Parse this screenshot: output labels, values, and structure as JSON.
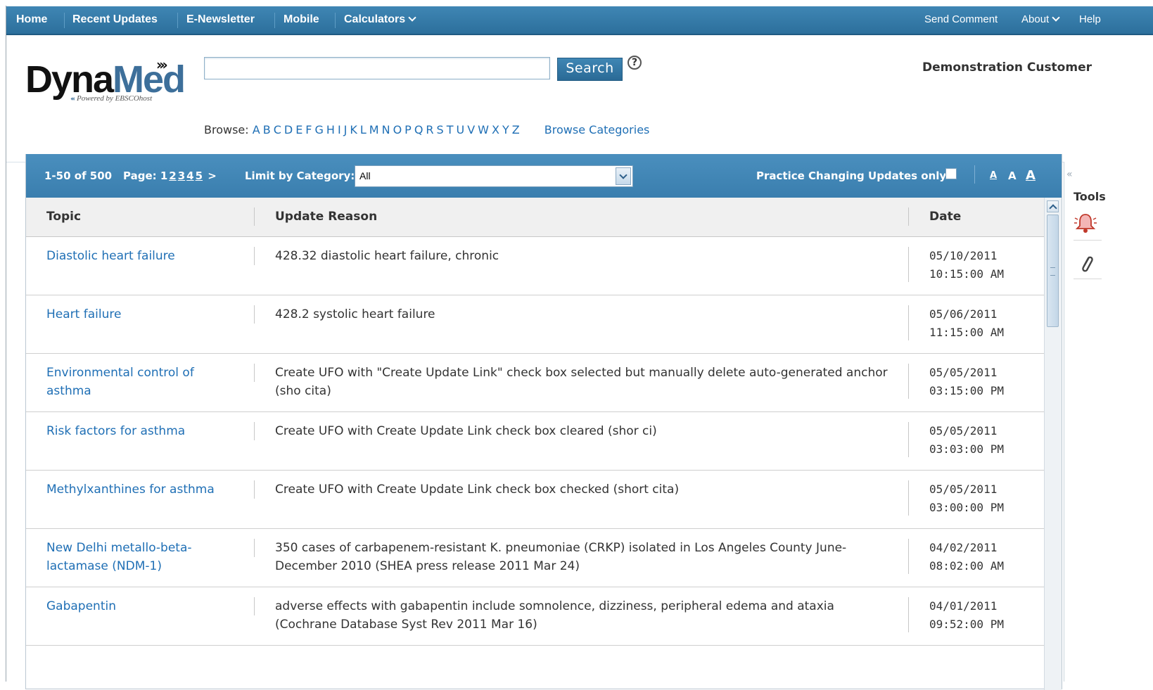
{
  "nav": {
    "left": [
      {
        "label": "Home"
      },
      {
        "label": "Recent Updates"
      },
      {
        "label": "E-Newsletter"
      },
      {
        "label": "Mobile"
      },
      {
        "label": "Calculators"
      }
    ],
    "right": [
      {
        "label": "Send Comment"
      },
      {
        "label": "About"
      },
      {
        "label": "Help"
      }
    ]
  },
  "logo": {
    "part1": "Dyna",
    "part2": "Med",
    "arrows": "›››",
    "powered_arrows": "‹‹‹",
    "powered_by": "Powered by EBSCOhost"
  },
  "search": {
    "value": "",
    "button_label": "Search",
    "help_icon": "?"
  },
  "customer": "Demonstration Customer",
  "browse": {
    "label": "Browse:",
    "letters": [
      "A",
      "B",
      "C",
      "D",
      "E",
      "F",
      "G",
      "H",
      "I",
      "J",
      "K",
      "L",
      "M",
      "N",
      "O",
      "P",
      "Q",
      "R",
      "S",
      "T",
      "U",
      "V",
      "W",
      "X",
      "Y",
      "Z"
    ],
    "categories_link": "Browse Categories"
  },
  "toolbar": {
    "range": "1-50 of 500",
    "page_label": "Page:",
    "pages": [
      "1",
      "2",
      "3",
      "4",
      "5"
    ],
    "next": ">",
    "limit_label": "Limit by Category:",
    "category_selected": "All",
    "practice_label": "Practice Changing Updates only",
    "practice_checked": false,
    "font_sizes": [
      "A",
      "A",
      "A"
    ]
  },
  "table": {
    "headers": {
      "topic": "Topic",
      "reason": "Update Reason",
      "date": "Date"
    },
    "rows": [
      {
        "topic": "Diastolic heart failure",
        "reason": "428.32 diastolic heart failure, chronic",
        "date": "05/10/2011",
        "time": "10:15:00 AM"
      },
      {
        "topic": "Heart failure",
        "reason": "428.2 systolic heart failure",
        "date": "05/06/2011",
        "time": "11:15:00 AM"
      },
      {
        "topic": "Environmental control of asthma",
        "reason": "Create UFO with \"Create Update Link\" check box selected but manually delete auto-generated anchor (sho cita)",
        "date": "05/05/2011",
        "time": "03:15:00 PM"
      },
      {
        "topic": "Risk factors for asthma",
        "reason": "Create UFO with Create Update Link check box cleared (shor ci)",
        "date": "05/05/2011",
        "time": "03:03:00 PM"
      },
      {
        "topic": "Methylxanthines for asthma",
        "reason": "Create UFO with Create Update Link check box checked (short cita)",
        "date": "05/05/2011",
        "time": "03:00:00 PM"
      },
      {
        "topic": "New Delhi metallo-beta-lactamase (NDM-1)",
        "reason": "350 cases of carbapenem-resistant K. pneumoniae (CRKP) isolated in Los Angeles County June-December 2010 (SHEA press release 2011 Mar 24)",
        "date": "04/02/2011",
        "time": "08:02:00 AM"
      },
      {
        "topic": "Gabapentin",
        "reason": "adverse effects with gabapentin include somnolence, dizziness, peripheral edema and ataxia (Cochrane Database Syst Rev 2011 Mar 16)",
        "date": "04/01/2011",
        "time": "09:52:00 PM"
      }
    ]
  },
  "tools": {
    "collapse": "«",
    "label": "Tools",
    "icons": [
      "alert-bell-icon",
      "paperclip-link-icon"
    ]
  },
  "colors": {
    "nav_bg": "#3a7eae",
    "link": "#1f6fb5",
    "header_bg": "#f0f0f0"
  }
}
